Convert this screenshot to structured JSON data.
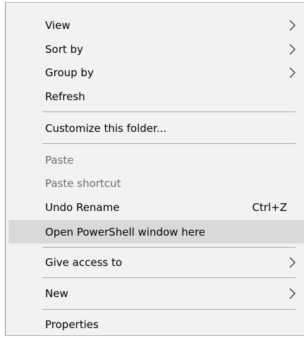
{
  "context_menu": {
    "items": {
      "view": {
        "label": "View",
        "icon": "chevron-right-icon"
      },
      "sort_by": {
        "label": "Sort by",
        "icon": "chevron-right-icon"
      },
      "group_by": {
        "label": "Group by",
        "icon": "chevron-right-icon"
      },
      "refresh": {
        "label": "Refresh"
      },
      "customize": {
        "label": "Customize this folder..."
      },
      "paste": {
        "label": "Paste",
        "disabled": true
      },
      "paste_shortcut": {
        "label": "Paste shortcut",
        "disabled": true
      },
      "undo_rename": {
        "label": "Undo Rename",
        "shortcut": "Ctrl+Z"
      },
      "open_powershell": {
        "label": "Open PowerShell window here",
        "highlighted": true
      },
      "give_access": {
        "label": "Give access to",
        "icon": "chevron-right-icon"
      },
      "new": {
        "label": "New",
        "icon": "chevron-right-icon"
      },
      "properties": {
        "label": "Properties"
      }
    },
    "colors": {
      "menu_background": "#f2f2f2",
      "highlight": "#d9d9d9",
      "separator": "#a8a8a8",
      "disabled_text": "#6d6d6d"
    }
  }
}
